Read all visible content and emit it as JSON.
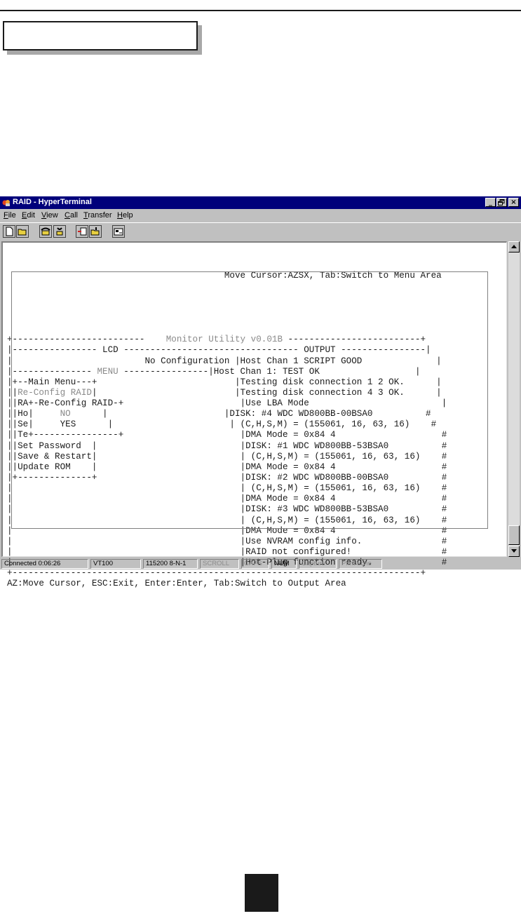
{
  "window": {
    "title": "RAID - HyperTerminal",
    "controls": [
      "_",
      "×"
    ]
  },
  "menu": {
    "items": [
      {
        "label": "File",
        "accel": "F",
        "rest": "ile"
      },
      {
        "label": "Edit",
        "accel": "E",
        "rest": "dit"
      },
      {
        "label": "View",
        "accel": "V",
        "rest": "iew"
      },
      {
        "label": "Call",
        "accel": "C",
        "rest": "all"
      },
      {
        "label": "Transfer",
        "accel": "T",
        "rest": "ransfer"
      },
      {
        "label": "Help",
        "accel": "H",
        "rest": "elp"
      }
    ]
  },
  "toolbar": {
    "buttons": [
      "new-icon",
      "open-icon",
      "connect-icon",
      "disconnect-icon",
      "send-icon",
      "receive-icon",
      "properties-icon"
    ]
  },
  "terminal": {
    "hint_top": "                                         Move Cursor:AZSX, Tab:Switch to Menu Area",
    "rows": [
      {
        "parts": [
          {
            "t": "+-------------------------    "
          },
          {
            "t": "Monitor Utility v0.01B",
            "grey": true
          },
          {
            "t": " -------------------------+"
          }
        ]
      },
      {
        "parts": [
          {
            "t": "|---------------- LCD --------------------------------- OUTPUT ----------------|"
          }
        ]
      },
      {
        "parts": [
          {
            "t": "|                         No Configuration |Host Chan 1 SCRIPT GOOD              |"
          }
        ]
      },
      {
        "parts": [
          {
            "t": "|--------------- "
          },
          {
            "t": "MENU",
            "grey": true
          },
          {
            "t": " ----------------|Host Chan 1: TEST OK                  |"
          }
        ]
      },
      {
        "parts": [
          {
            "t": "|+--Main Menu---+                          |Testing disk connection 1 2 OK.      |"
          }
        ]
      },
      {
        "parts": [
          {
            "t": "||"
          },
          {
            "t": "Re-Config RAID",
            "grey": true
          },
          {
            "t": "|                          |Testing disk connection 4 3 OK.      |"
          }
        ]
      },
      {
        "parts": [
          {
            "t": "||RA+-Re-Config RAID-+                      |Use LBA Mode                         |"
          }
        ]
      },
      {
        "parts": [
          {
            "t": "||Ho|     "
          },
          {
            "t": "NO",
            "grey": true
          },
          {
            "t": "      |                      |DISK: #4 WDC WD800BB-00BSA0          #"
          }
        ]
      },
      {
        "parts": [
          {
            "t": "||Se|     YES      |                      | (C,H,S,M) = (155061, 16, 63, 16)    #"
          }
        ]
      },
      {
        "parts": [
          {
            "t": "||Te+----------------+                      |DMA Mode = 0x84 4                    #"
          }
        ]
      },
      {
        "parts": [
          {
            "t": "||Set Password  |                           |DISK: #1 WDC WD800BB-53BSA0          #"
          }
        ]
      },
      {
        "parts": [
          {
            "t": "||Save & Restart|                           | (C,H,S,M) = (155061, 16, 63, 16)    #"
          }
        ]
      },
      {
        "parts": [
          {
            "t": "||Update ROM    |                           |DMA Mode = 0x84 4                    #"
          }
        ]
      },
      {
        "parts": [
          {
            "t": "|+--------------+                           |DISK: #2 WDC WD800BB-00BSA0          #"
          }
        ]
      },
      {
        "parts": [
          {
            "t": "|                                           | (C,H,S,M) = (155061, 16, 63, 16)    #"
          }
        ]
      },
      {
        "parts": [
          {
            "t": "|                                           |DMA Mode = 0x84 4                    #"
          }
        ]
      },
      {
        "parts": [
          {
            "t": "|                                           |DISK: #3 WDC WD800BB-53BSA0          #"
          }
        ]
      },
      {
        "parts": [
          {
            "t": "|                                           | (C,H,S,M) = (155061, 16, 63, 16)    #"
          }
        ]
      },
      {
        "parts": [
          {
            "t": "|                                           |DMA Mode = 0x84 4                    #"
          }
        ]
      },
      {
        "parts": [
          {
            "t": "|                                           |Use NVRAM config info.               #"
          }
        ]
      },
      {
        "parts": [
          {
            "t": "|                                           |RAID not configured!                 #"
          }
        ]
      },
      {
        "parts": [
          {
            "t": "|                                           |Hot-Plug function ready.             #"
          }
        ]
      },
      {
        "parts": [
          {
            "t": "+-----------------------------------------------------------------------------+"
          }
        ]
      },
      {
        "parts": [
          {
            "t": "AZ:Move Cursor, ESC:Exit, Enter:Enter, Tab:Switch to Output Area"
          }
        ]
      }
    ]
  },
  "status": {
    "items": [
      {
        "label": "Connected 0:06:26",
        "dim": false
      },
      {
        "label": "VT100",
        "dim": false
      },
      {
        "label": "115200 8-N-1",
        "dim": false
      },
      {
        "label": "SCROLL",
        "dim": true
      },
      {
        "label": "CAPS",
        "dim": true
      },
      {
        "label": "NUM",
        "dim": false
      },
      {
        "label": "Capture",
        "dim": true
      },
      {
        "label": "Print echo",
        "dim": true
      }
    ]
  },
  "colors": {
    "titlebar": "#00007b",
    "window_face": "#c0c0c0",
    "terminal_bg": "#ffffff",
    "terminal_text": "#1a1a1a",
    "dim_text": "#8a8a8a"
  }
}
